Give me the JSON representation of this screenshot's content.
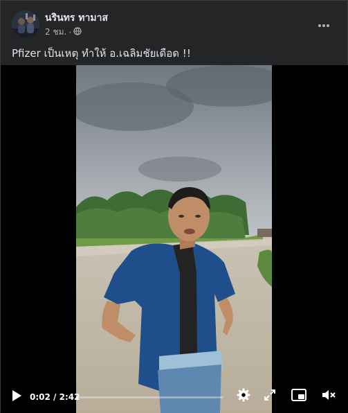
{
  "post": {
    "author": "นรินทร ทามาส",
    "time_ago": "2 ชม.",
    "meta_separator": "·",
    "caption": "Pfizer เป็นเหตุ ทำให้ อ.เฉลิมชัยเดือด !!"
  },
  "video": {
    "current_time": "0:02",
    "duration": "2:42",
    "time_separator": " / ",
    "progress_fraction": 0.012
  },
  "icons": {
    "privacy": "globe-icon",
    "more": "more-horizontal-icon",
    "play": "play-icon",
    "settings": "gear-icon",
    "fullscreen": "expand-icon",
    "pip": "picture-in-picture-icon",
    "volume": "volume-icon"
  },
  "colors": {
    "background": "#242526",
    "text_primary": "#e4e6eb",
    "text_secondary": "#b0b3b8",
    "video_bg": "#000000"
  }
}
